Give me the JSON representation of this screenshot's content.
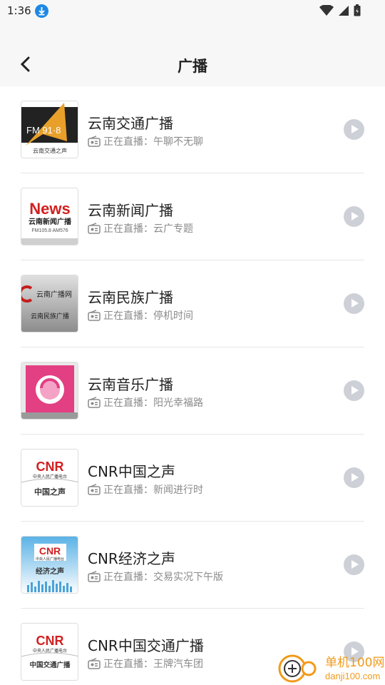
{
  "status": {
    "time": "1:36"
  },
  "header": {
    "title": "广播"
  },
  "live_prefix": "正在直播：",
  "stations": [
    {
      "name": "云南交通广播",
      "program": "午聊不无聊",
      "logo": "云南交通之声"
    },
    {
      "name": "云南新闻广播",
      "program": "云广专题",
      "logo": "云南新闻广播"
    },
    {
      "name": "云南民族广播",
      "program": "停机时间",
      "logo": "云南民族广播"
    },
    {
      "name": "云南音乐广播",
      "program": "阳光幸福路",
      "logo": ""
    },
    {
      "name": "CNR中国之声",
      "program": "新闻进行时",
      "logo": "中国之声"
    },
    {
      "name": "CNR经济之声",
      "program": "交易实况下午版",
      "logo": "经济之声"
    },
    {
      "name": "CNR中国交通广播",
      "program": "王牌汽车团",
      "logo": "中国交通广播"
    }
  ],
  "logo_texts": {
    "fm": "FM 91·8",
    "news": "News",
    "news_freq": "FM105.8  AM576",
    "ethnic_site": "云南广播网",
    "cnr": "CNR",
    "cnr_sub": "中央人民广播电台"
  },
  "watermark": {
    "site": "单机100网",
    "url": "danji100.com"
  }
}
